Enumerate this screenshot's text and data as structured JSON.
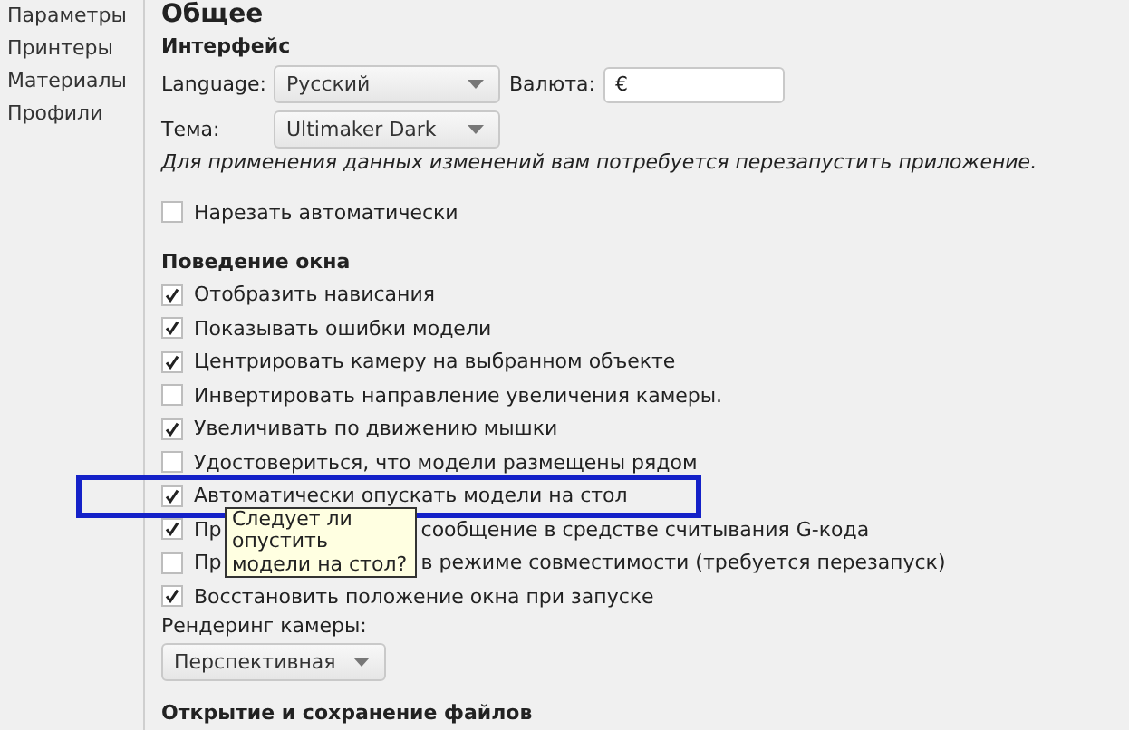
{
  "sidebar": {
    "items": [
      "Параметры",
      "Принтеры",
      "Материалы",
      "Профили"
    ]
  },
  "page_title": "Общее",
  "interface": {
    "heading": "Интерфейс",
    "language": {
      "label": "Language:",
      "value": "Русский"
    },
    "currency": {
      "label": "Валюта:",
      "value": "€"
    },
    "theme": {
      "label": "Тема:",
      "value": "Ultimaker Dark"
    },
    "restart_note": "Для применения данных изменений вам потребуется перезапустить приложение.",
    "auto_slice": {
      "label": "Нарезать автоматически",
      "checked": false
    }
  },
  "window_behavior": {
    "heading": "Поведение окна",
    "options": [
      {
        "label": "Отобразить нависания",
        "checked": true,
        "highlighted": false
      },
      {
        "label": "Показывать ошибки модели",
        "checked": true,
        "highlighted": false
      },
      {
        "label": "Центрировать камеру на выбранном объекте",
        "checked": true,
        "highlighted": false
      },
      {
        "label": "Инвертировать направление увеличения камеры.",
        "checked": false,
        "highlighted": false
      },
      {
        "label": "Увеличивать по движению мышки",
        "checked": true,
        "highlighted": false
      },
      {
        "label": "Удостовериться, что модели размещены рядом",
        "checked": false,
        "highlighted": false
      },
      {
        "label": "Автоматически опускать модели на стол",
        "checked": true,
        "highlighted": true,
        "tooltip": "Следует ли опустить модели на стол?"
      },
      {
        "label": "Пр",
        "label_tail": "сообщение в средстве считывания G-кода",
        "checked": true,
        "highlighted": false
      },
      {
        "label": "Пр",
        "label_tail": "в режиме совместимости (требуется перезапуск)",
        "checked": false,
        "highlighted": false
      },
      {
        "label": "Восстановить положение окна при запуске",
        "checked": true,
        "highlighted": false
      }
    ],
    "camera_rendering": {
      "label": "Рендеринг камеры:",
      "value": "Перспективная"
    }
  },
  "file_section": {
    "heading": "Открытие и сохранение файлов"
  }
}
